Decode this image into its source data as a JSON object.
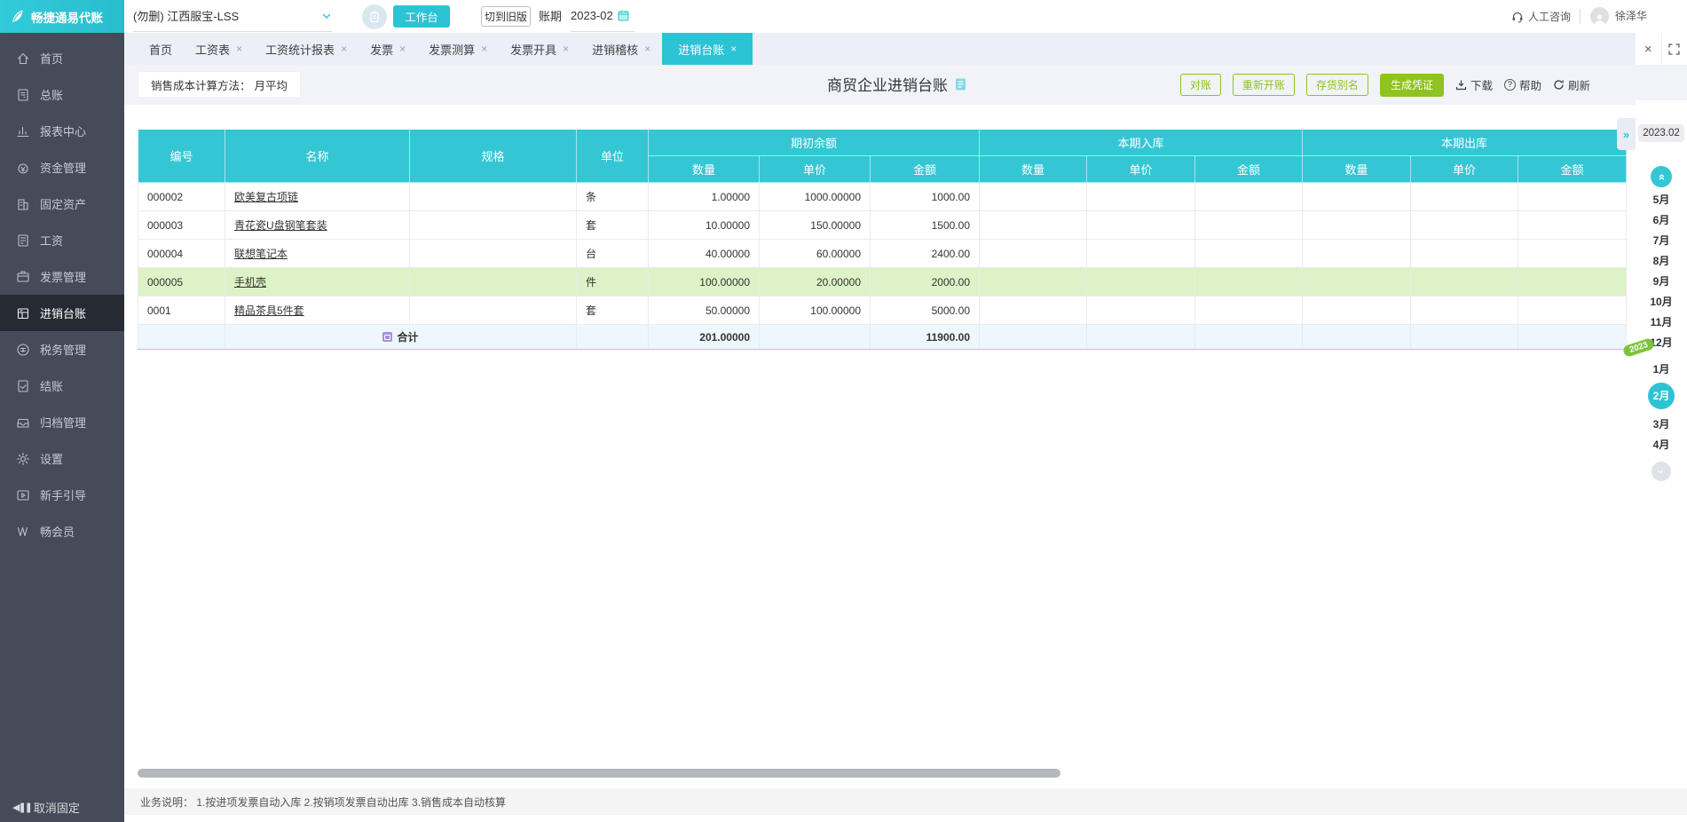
{
  "topbar": {
    "logo_text": "畅捷通易代账",
    "company": "(勿删) 江西服宝-LSS",
    "workbench_label": "工作台",
    "switch_old_label": "切到旧版",
    "period_label": "账期",
    "period_value": "2023-02",
    "consult_label": "人工咨询",
    "user_name": "徐泽华"
  },
  "sidebar": {
    "unpin_label": "取消固定",
    "items": [
      {
        "key": "home",
        "label": "首页",
        "active": false
      },
      {
        "key": "general-ledger",
        "label": "总账",
        "active": false
      },
      {
        "key": "report-center",
        "label": "报表中心",
        "active": false
      },
      {
        "key": "funds",
        "label": "资金管理",
        "active": false
      },
      {
        "key": "fixed-assets",
        "label": "固定资产",
        "active": false
      },
      {
        "key": "payroll",
        "label": "工资",
        "active": false
      },
      {
        "key": "invoice",
        "label": "发票管理",
        "active": false
      },
      {
        "key": "purchase-sale-ledger",
        "label": "进销台账",
        "active": true
      },
      {
        "key": "tax",
        "label": "税务管理",
        "active": false
      },
      {
        "key": "closing",
        "label": "结账",
        "active": false
      },
      {
        "key": "archive",
        "label": "归档管理",
        "active": false
      },
      {
        "key": "settings",
        "label": "设置",
        "active": false
      },
      {
        "key": "guide",
        "label": "新手引导",
        "active": false
      },
      {
        "key": "member",
        "label": "畅会员",
        "active": false
      }
    ]
  },
  "tabs": [
    {
      "label": "首页",
      "closable": false,
      "active": false
    },
    {
      "label": "工资表",
      "closable": true,
      "active": false
    },
    {
      "label": "工资统计报表",
      "closable": true,
      "active": false
    },
    {
      "label": "发票",
      "closable": true,
      "active": false
    },
    {
      "label": "发票测算",
      "closable": true,
      "active": false
    },
    {
      "label": "发票开具",
      "closable": true,
      "active": false
    },
    {
      "label": "进销稽核",
      "closable": true,
      "active": false
    },
    {
      "label": "进销台账",
      "closable": true,
      "active": true
    }
  ],
  "toolbar": {
    "cost_method_label": "销售成本计算方法：",
    "cost_method_value": "月平均",
    "page_title": "商贸企业进销台账",
    "reconcile_label": "对账",
    "reopen_label": "重新开账",
    "alias_label": "存货别名",
    "voucher_label": "生成凭证",
    "download_label": "下载",
    "help_label": "帮助",
    "refresh_label": "刷新"
  },
  "table": {
    "col_headers": [
      "编号",
      "名称",
      "规格",
      "单位"
    ],
    "group_headers": [
      "期初余额",
      "本期入库",
      "本期出库"
    ],
    "sub_headers": [
      "数量",
      "单价",
      "金额"
    ],
    "rows": [
      {
        "code": "000002",
        "name": "欧美复古项链",
        "spec": "",
        "unit": "条",
        "open_qty": "1.00000",
        "open_price": "1000.00000",
        "open_amount": "1000.00",
        "highlight": false
      },
      {
        "code": "000003",
        "name": "青花瓷U盘钢笔套装",
        "spec": "",
        "unit": "套",
        "open_qty": "10.00000",
        "open_price": "150.00000",
        "open_amount": "1500.00",
        "highlight": false
      },
      {
        "code": "000004",
        "name": "联想笔记本",
        "spec": "",
        "unit": "台",
        "open_qty": "40.00000",
        "open_price": "60.00000",
        "open_amount": "2400.00",
        "highlight": false
      },
      {
        "code": "000005",
        "name": "手机壳",
        "spec": "",
        "unit": "件",
        "open_qty": "100.00000",
        "open_price": "20.00000",
        "open_amount": "2000.00",
        "highlight": true
      },
      {
        "code": "0001",
        "name": "精品茶具5件套",
        "spec": "",
        "unit": "套",
        "open_qty": "50.00000",
        "open_price": "100.00000",
        "open_amount": "5000.00",
        "highlight": false
      }
    ],
    "total": {
      "label": "合计",
      "open_qty": "201.00000",
      "open_amount": "11900.00"
    }
  },
  "calendar": {
    "current_period": "2023.02",
    "year_badge": "2023",
    "months_top": [
      "5月",
      "6月",
      "7月",
      "8月",
      "9月",
      "10月",
      "11月",
      "12月"
    ],
    "months_bottom": [
      "1月",
      "2月",
      "3月",
      "4月"
    ],
    "active_month": "2月"
  },
  "footer": {
    "note": "业务说明： 1.按进项发票自动入库  2.按销项发票自动出库  3.销售成本自动核算"
  },
  "colors": {
    "accent": "#2cc3d4",
    "table_header": "#35c6d4",
    "green": "#8fc31f",
    "row_highlight": "#ddf2c6",
    "total_row": "#edf7fc",
    "sidebar_bg": "#454b58",
    "sidebar_active": "#262a33",
    "tabbar_bg": "#edeff6"
  }
}
